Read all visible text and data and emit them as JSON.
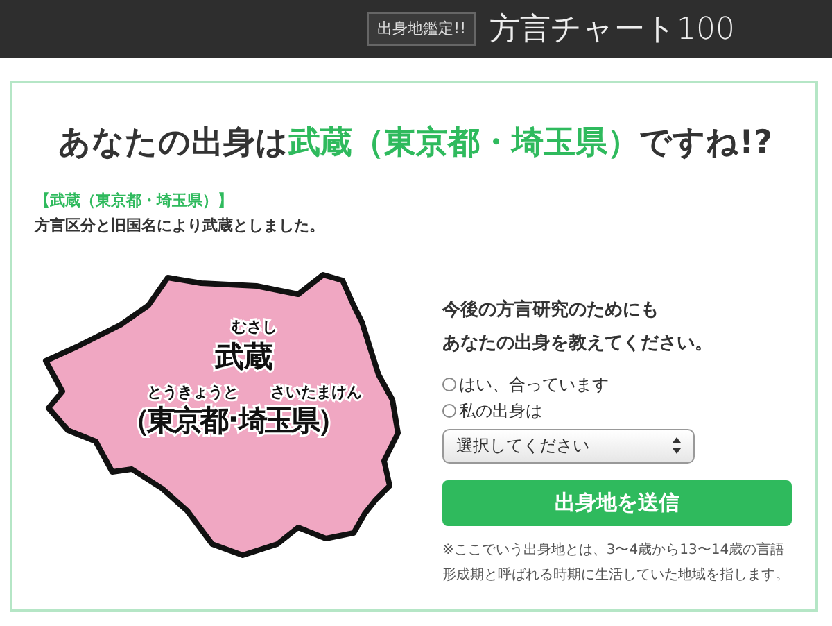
{
  "header": {
    "badge": "出身地鑑定!!",
    "title": "方言チャート100"
  },
  "result": {
    "heading": {
      "before": "あなたの出身は",
      "highlight": "武蔵（東京都・埼玉県）",
      "after": "ですね!?"
    },
    "region_label": "【武蔵（東京都・埼玉県）】",
    "explanation": "方言区分と旧国名により武蔵としました。",
    "map": {
      "reading": "むさし",
      "name": "武蔵",
      "readings_2": [
        "とうきょうと",
        "さいたまけん"
      ],
      "prefectures": "（東京都･埼玉県）"
    }
  },
  "form": {
    "prompt": [
      "今後の方言研究のためにも",
      "あなたの出身を教えてください。"
    ],
    "options": [
      {
        "label": "はい、合っています",
        "selected": false
      },
      {
        "label": "私の出身は",
        "selected": false
      }
    ],
    "select": {
      "placeholder": "選択してください"
    },
    "submit": "出身地を送信",
    "note": "※ここでいう出身地とは、3〜4歳から13〜14歳の言語形成期と呼ばれる時期に生活していた地域を指します。"
  }
}
